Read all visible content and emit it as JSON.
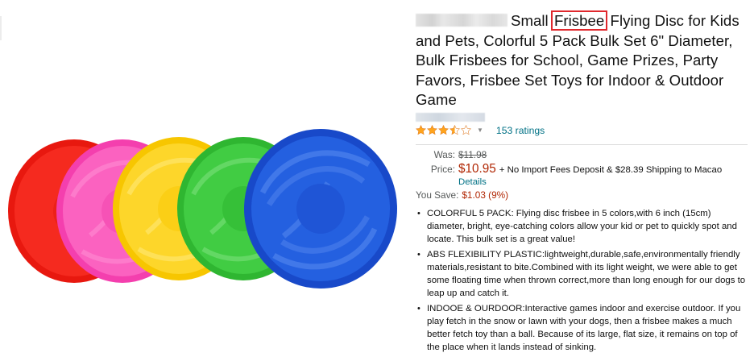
{
  "product": {
    "title_before": "Small",
    "title_highlight": "Frisbee",
    "title_after": "Flying Disc for Kids and Pets, Colorful 5 Pack Bulk Set 6\" Diameter, Bulk Frisbees for School, Game Prizes, Party Favors, Frisbee Set Toys for Indoor & Outdoor Game",
    "rating_stars": 3.5,
    "ratings_count": "153 ratings"
  },
  "pricing": {
    "was_label": "Was:",
    "was_value": "$11.98",
    "price_label": "Price:",
    "price_value": "$10.95",
    "shipping_text": "+ No Import Fees Deposit & $28.39 Shipping to Macao",
    "details_link": "Details",
    "save_label": "You Save:",
    "save_value": "$1.03 (9%)"
  },
  "bullets": [
    "COLORFUL 5 PACK: Flying disc frisbee in 5 colors,with 6 inch (15cm) diameter, bright, eye-catching colors allow your kid or pet to quickly spot and locate. This bulk set is a great value!",
    "ABS FLEXIBILITY PLASTIC:lightweight,durable,safe,environmentally friendly materials,resistant to bite.Combined with its light weight, we were able to get some floating time when thrown correct,more than long enough for our dogs to leap up and catch it.",
    "INDOOE & OURDOOR:Interactive games indoor and exercise outdoor. If you play fetch in the snow or lawn with your dogs, then a frisbee makes a much better fetch toy than a ball. Because of its large, flat size, it remains on top of the place when it lands instead of sinking."
  ],
  "colors": {
    "frisbees": [
      "#f01e14",
      "#f94fb4",
      "#fbd113",
      "#39c43b",
      "#1f5bde"
    ],
    "price_red": "#B12704",
    "link": "#007185",
    "star": "#FFA41C",
    "highlight_border": "#e0282d"
  }
}
